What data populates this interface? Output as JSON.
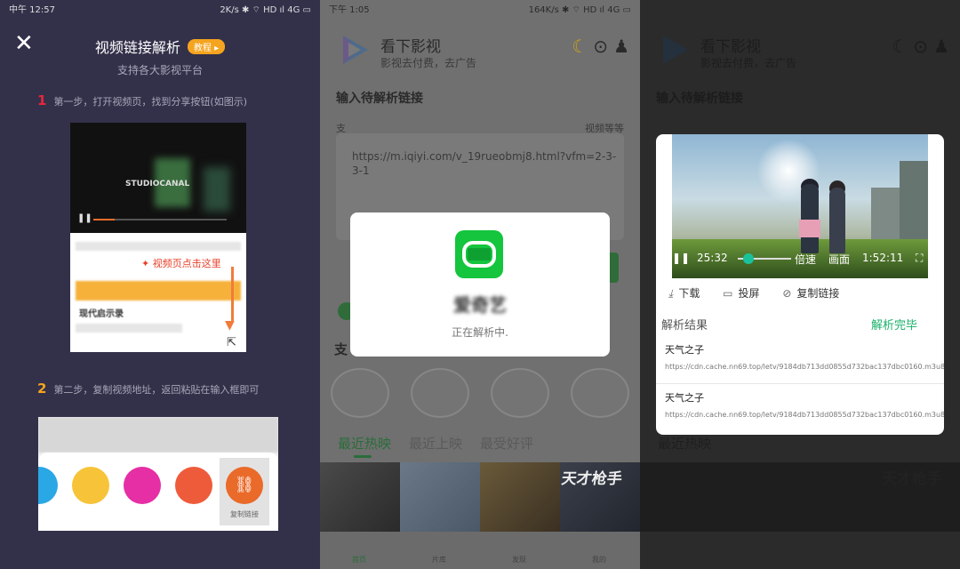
{
  "panel1": {
    "status_time": "中午 12:57",
    "status_right": "2K/s ✱ ⌔ HD ıl 4G ▭",
    "title": "视频链接解析",
    "badge": "教程",
    "subtitle": "支持各大影视平台",
    "step1_num": "1",
    "step1_text": "第一步，打开视频页，找到分享按钮(如图示)",
    "step1_image_hint": "视频页点击这里",
    "step1_image_text": "STUDIOCANAL",
    "step1_image_bold": "现代启示录",
    "step2_num": "2",
    "step2_text": "第二步，复制视频地址，返回粘贴在输入框即可",
    "copy_link": "复制链接"
  },
  "panel2": {
    "status_time": "下午 1:05",
    "status_right": "164K/s ✱ ⌔ HD ıl 4G ▭",
    "app_name": "看下影视",
    "slogan": "影视去付费，去广告",
    "section_label": "输入待解析链接",
    "input_hint_left": "支",
    "input_hint_right": "视频等等",
    "url_value": "https://m.iqiyi.com/v_19rueobmj8.html?vfm=2-3-3-1",
    "supported_label": "支",
    "tabs": [
      "最近热映",
      "最近上映",
      "最受好评"
    ],
    "poster_word": "天才枪手",
    "nav": [
      "首页",
      "片库",
      "发现",
      "我的"
    ],
    "dialog_title": "爱奇艺",
    "dialog_status": "正在解析中."
  },
  "panel3": {
    "app_name": "看下影视",
    "slogan": "影视去付费，去广告",
    "section_label": "输入待解析链接",
    "tab_label": "最近热映",
    "poster_word": "天才枪手",
    "player_elapsed": "25:32",
    "player_speed": "倍速",
    "player_picture": "画面",
    "player_total": "1:52:11",
    "action_download": "下载",
    "action_cast": "投屏",
    "action_copy": "复制链接",
    "result_label": "解析结果",
    "result_status": "解析完毕",
    "results": [
      {
        "title": "天气之子",
        "url": "https://cdn.cache.nn69.top/letv/9184db713dd0855d732bac137dbc0160.m3u8"
      },
      {
        "title": "天气之子",
        "url": "https://cdn.cache.nn69.top/letv/9184db713dd0855d732bac137dbc0160.m3u8"
      }
    ]
  },
  "colors": {
    "panel1_bg": "#33314a",
    "badge": "#f5a41f",
    "step1_number": "#e8263c",
    "step2_number": "#f5a41f",
    "iqiyi_green": "#14c53d",
    "result_done": "#1ab06a",
    "player_knob": "#19c29b"
  }
}
